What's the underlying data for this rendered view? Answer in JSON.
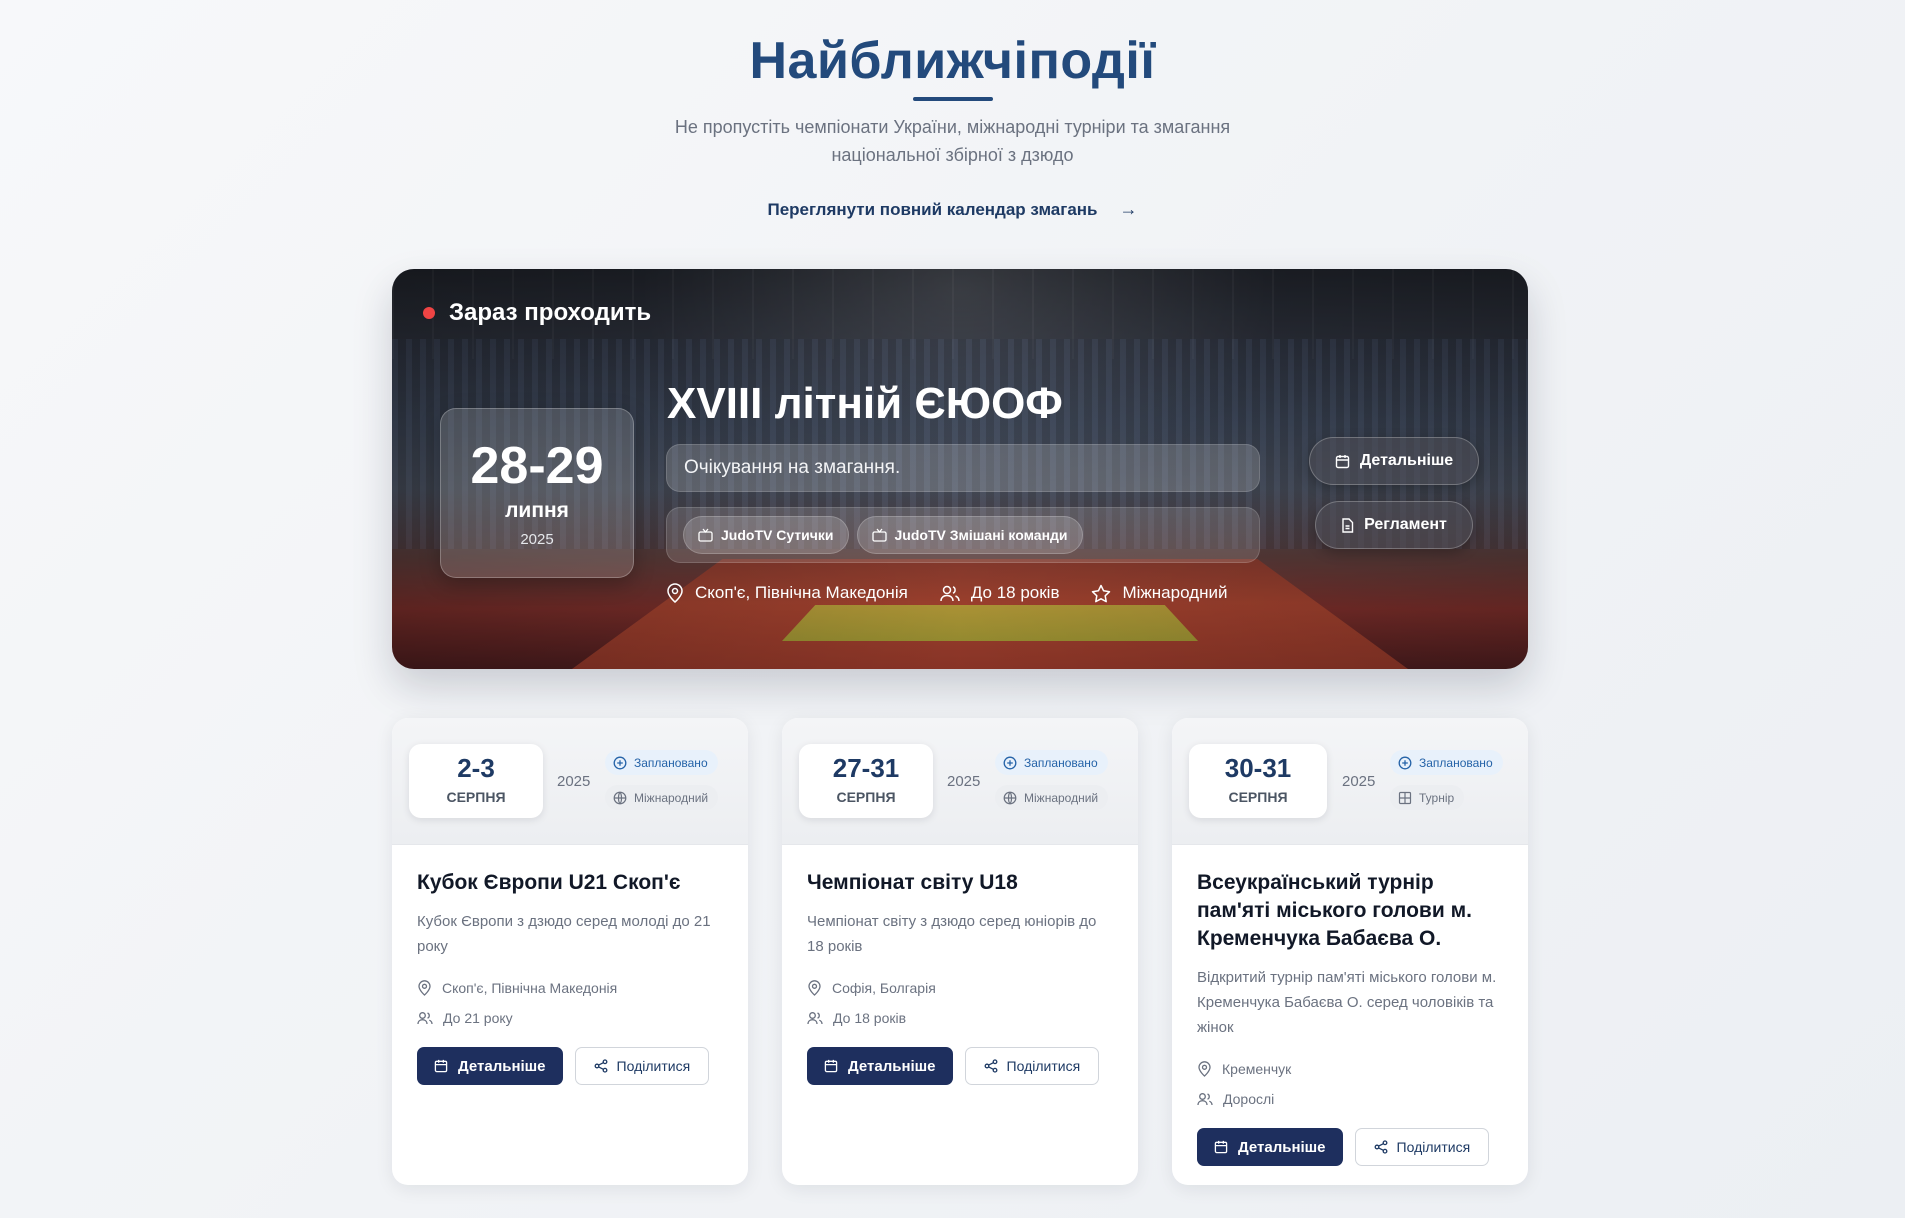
{
  "header": {
    "title": "Найближчіподії",
    "subtitle": "Не пропустіть чемпіонати України, міжнародні турніри та змагання національної збірної з дзюдо",
    "calendar_link": "Переглянути повний календар змагань",
    "calendar_arrow": "→"
  },
  "featured": {
    "live_label": "Зараз проходить",
    "date_range": "28-29",
    "month": "липня",
    "year": "2025",
    "title": "XVIII літній ЄЮОФ",
    "description": "Очікування на змагання.",
    "streams": [
      "JudoTV Сутички",
      "JudoTV Змішані команди"
    ],
    "location": "Скоп'є, Північна Македонія",
    "age": "До 18 років",
    "level": "Міжнародний",
    "details_button": "Детальніше",
    "rules_button": "Регламент",
    "colors": {
      "live_dot": "#ef4444"
    }
  },
  "events": [
    {
      "date_range": "2-3",
      "month": "СЕРПНЯ",
      "year": "2025",
      "status": "Заплановано",
      "type": "Міжнародний",
      "type_icon": "globe-icon",
      "title": "Кубок Європи U21 Скоп'є",
      "description": "Кубок Європи з дзюдо серед молоді до 21 року",
      "location": "Скоп'є, Північна Македонія",
      "age": "До 21 року",
      "details_button": "Детальніше",
      "share_button": "Поділитися"
    },
    {
      "date_range": "27-31",
      "month": "СЕРПНЯ",
      "year": "2025",
      "status": "Заплановано",
      "type": "Міжнародний",
      "type_icon": "globe-icon",
      "title": "Чемпіонат світу U18",
      "description": "Чемпіонат світу з дзюдо серед юніорів до 18 років",
      "location": "Софія, Болгарія",
      "age": "До 18 років",
      "details_button": "Детальніше",
      "share_button": "Поділитися"
    },
    {
      "date_range": "30-31",
      "month": "СЕРПНЯ",
      "year": "2025",
      "status": "Заплановано",
      "type": "Турнір",
      "type_icon": "grid-icon",
      "title": "Всеукраїнський турнір пам'яті міського голови м. Кременчука Бабаєва О.",
      "description": "Відкритий турнір пам'яті міського голови м. Кременчука Бабаєва О. серед чоловіків та жінок",
      "location": "Кременчук",
      "age": "Дорослі",
      "details_button": "Детальніше",
      "share_button": "Поділитися"
    }
  ],
  "colors": {
    "primary": "#1e2f5e",
    "title": "#234a7c",
    "status_badge": "#2563a8"
  }
}
